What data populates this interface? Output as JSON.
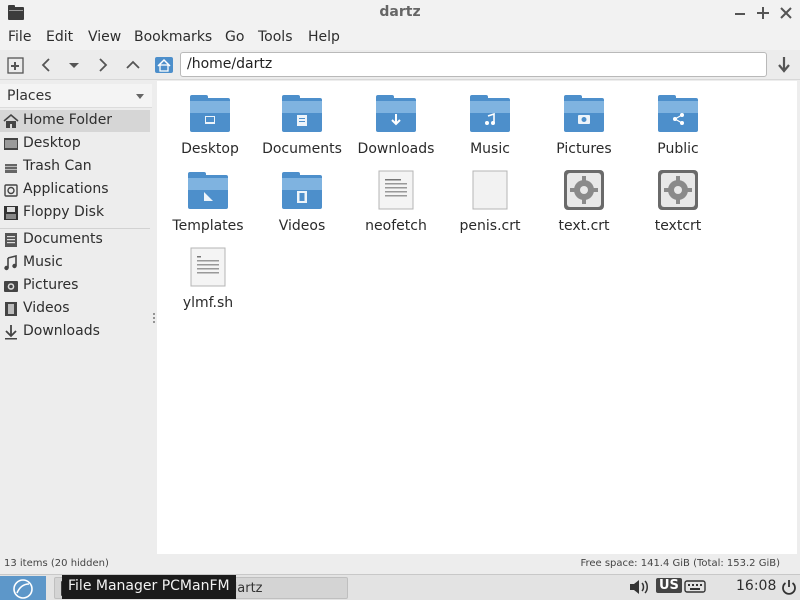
{
  "window": {
    "title": "dartz"
  },
  "menu": [
    "File",
    "Edit",
    "View",
    "Bookmarks",
    "Go",
    "Tools",
    "Help"
  ],
  "address": {
    "path": "/home/dartz"
  },
  "sidebar": {
    "header": "Places",
    "items": [
      {
        "label": "Home Folder",
        "icon": "home-icon"
      },
      {
        "label": "Desktop",
        "icon": "desktop-icon"
      },
      {
        "label": "Trash Can",
        "icon": "trash-icon"
      },
      {
        "label": "Applications",
        "icon": "applications-icon"
      },
      {
        "label": "Floppy Disk",
        "icon": "floppy-icon"
      }
    ],
    "bookmarks": [
      {
        "label": "Documents",
        "icon": "documents-icon"
      },
      {
        "label": "Music",
        "icon": "music-icon"
      },
      {
        "label": "Pictures",
        "icon": "pictures-icon"
      },
      {
        "label": "Videos",
        "icon": "videos-icon"
      },
      {
        "label": "Downloads",
        "icon": "downloads-icon"
      }
    ]
  },
  "files": [
    {
      "name": "Desktop",
      "type": "folder",
      "icon": "folder-desktop-icon"
    },
    {
      "name": "Documents",
      "type": "folder",
      "icon": "folder-documents-icon"
    },
    {
      "name": "Downloads",
      "type": "folder",
      "icon": "folder-downloads-icon"
    },
    {
      "name": "Music",
      "type": "folder",
      "icon": "folder-music-icon"
    },
    {
      "name": "Pictures",
      "type": "folder",
      "icon": "folder-pictures-icon"
    },
    {
      "name": "Public",
      "type": "folder",
      "icon": "folder-public-icon"
    },
    {
      "name": "Templates",
      "type": "folder",
      "icon": "folder-templates-icon"
    },
    {
      "name": "Videos",
      "type": "folder",
      "icon": "folder-videos-icon"
    },
    {
      "name": "neofetch",
      "type": "text",
      "icon": "text-file-icon"
    },
    {
      "name": "penis.crt",
      "type": "blank",
      "icon": "blank-file-icon"
    },
    {
      "name": "text.crt",
      "type": "certificate",
      "icon": "gear-file-icon"
    },
    {
      "name": "textcrt",
      "type": "certificate",
      "icon": "gear-file-icon"
    },
    {
      "name": "ylmf.sh",
      "type": "script",
      "icon": "script-file-icon"
    }
  ],
  "status": {
    "items": "13 items (20 hidden)",
    "free_space": "Free space: 141.4 GiB (Total: 153.2 GiB)"
  },
  "taskbar": {
    "task_label": "dartz",
    "tooltip": "File Manager PCManFM",
    "keyboard_layout": "US",
    "clock": "16:08"
  },
  "colors": {
    "folder_blue": "#4d8fcb",
    "folder_light": "#7fb3e0",
    "selection": "#d6d6d6",
    "start_button": "#5d97c9"
  }
}
